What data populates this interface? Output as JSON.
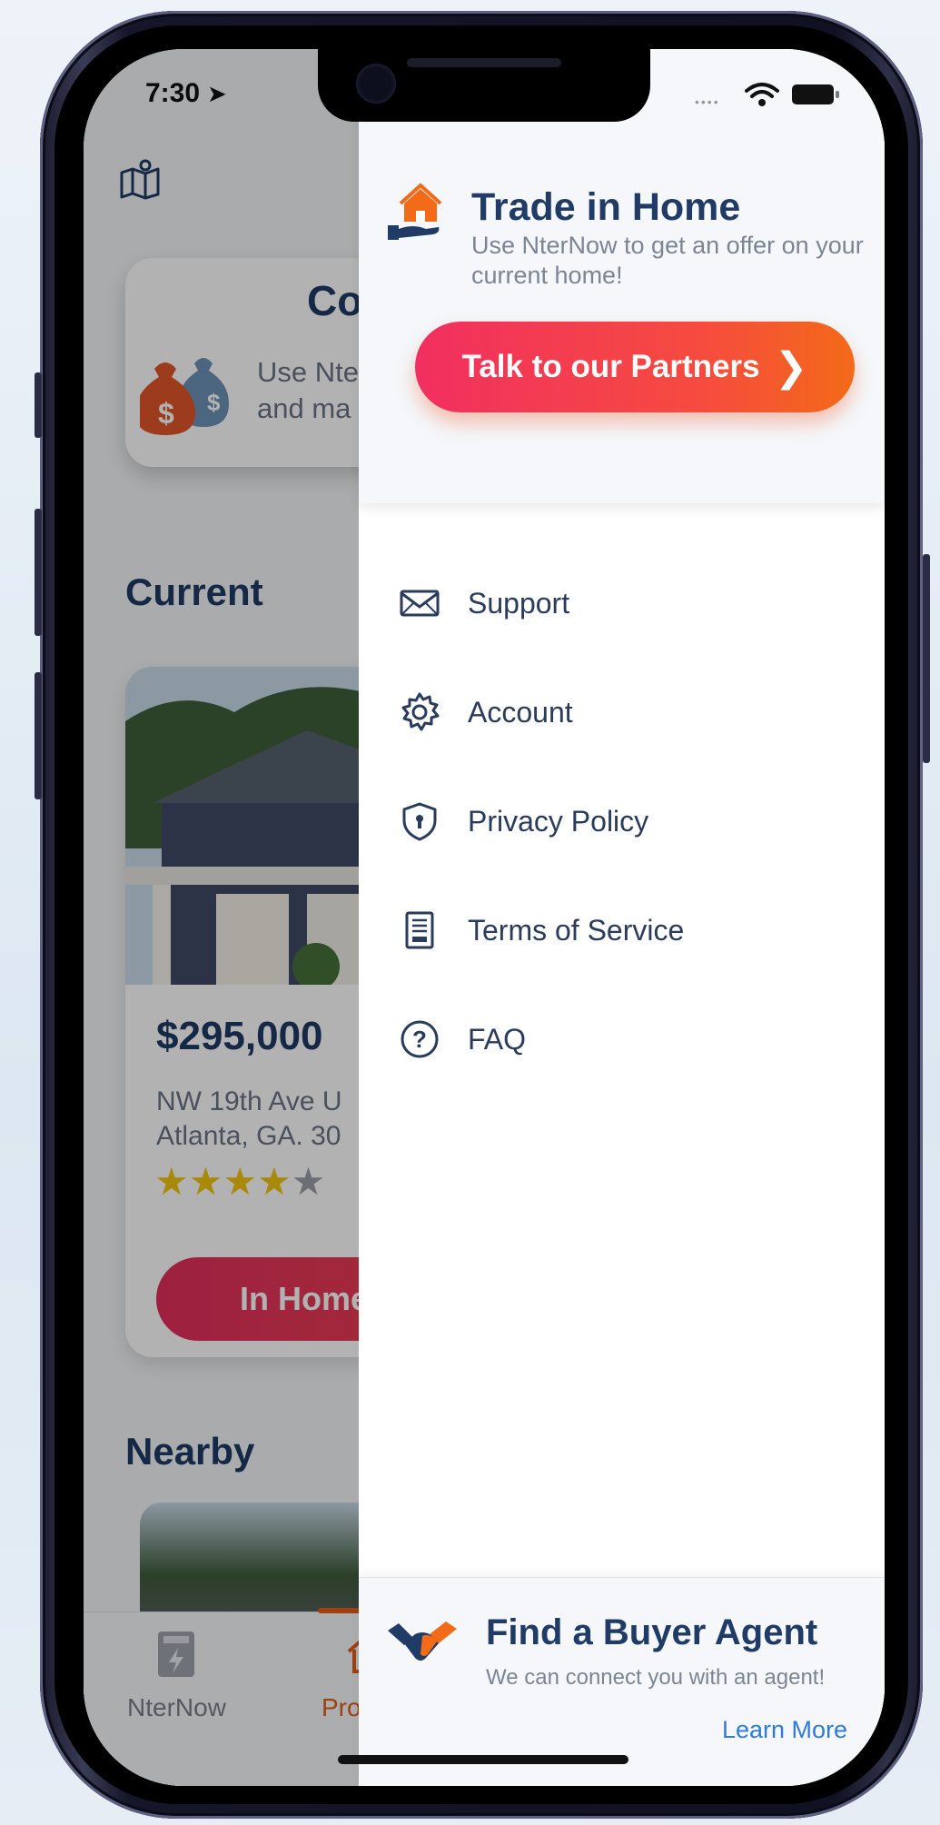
{
  "status_bar": {
    "time": "7:30",
    "location_arrow": "➤"
  },
  "background_app": {
    "contract_card": {
      "title": "Cont",
      "desc_line1": "Use Nte",
      "desc_line2": "and ma"
    },
    "current_section": "Current",
    "property": {
      "price": "$295,000",
      "address_line1": "NW 19th Ave U",
      "address_line2": "Atlanta, GA. 30",
      "rating": 4,
      "max_rating": 5,
      "button_label": "In Home"
    },
    "nearby_section": "Nearby",
    "tabs": [
      {
        "label": "NterNow",
        "icon": "meter-icon"
      },
      {
        "label": "Pro",
        "icon": "home-icon"
      }
    ]
  },
  "drawer": {
    "trade_in": {
      "title": "Trade in Home",
      "description": "Use NterNow to get an offer on your current home!",
      "button_label": "Talk to our Partners"
    },
    "menu": [
      {
        "label": "Support",
        "icon": "envelope-icon"
      },
      {
        "label": "Account",
        "icon": "gear-icon"
      },
      {
        "label": "Privacy Policy",
        "icon": "shield-icon"
      },
      {
        "label": "Terms of Service",
        "icon": "document-icon"
      },
      {
        "label": "FAQ",
        "icon": "question-icon"
      }
    ],
    "buyer_agent": {
      "title": "Find a Buyer Agent",
      "description": "We can connect you with an agent!",
      "link_label": "Learn More"
    }
  },
  "colors": {
    "navy": "#1f3b66",
    "accent_orange": "#f36a18",
    "accent_pink": "#f12f60",
    "link_blue": "#2f7bdb",
    "star_gold": "#f1c40f"
  }
}
